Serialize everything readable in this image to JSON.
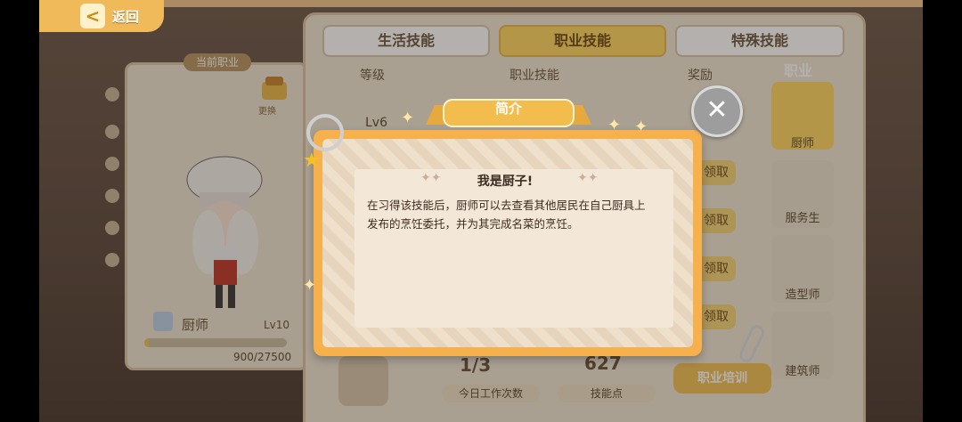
{
  "topbar": {
    "back_label": "返回"
  },
  "character": {
    "job_tag": "当前职业",
    "change_label": "更换",
    "name": "厨师",
    "level": "Lv10",
    "xp_text": "900/27500",
    "xp_fraction": 0.0327
  },
  "tabs": [
    {
      "label": "生活技能"
    },
    {
      "label": "职业技能"
    },
    {
      "label": "特殊技能"
    }
  ],
  "table": {
    "headers": [
      "等级",
      "职业技能",
      "奖励"
    ],
    "first_row_level": "Lv6",
    "claim_label": "领取"
  },
  "job_list": {
    "title": "职业",
    "items": [
      "厨师",
      "服务生",
      "造型师",
      "建筑师"
    ]
  },
  "stats": {
    "count_value": "1/3",
    "count_label": "今日工作次数",
    "points_value": "627",
    "points_label": "技能点",
    "train_label": "职业培训"
  },
  "modal": {
    "title": "简介",
    "heading": "我是厨子!",
    "text": "在习得该技能后，厨师可以去查看其他居民在自己厨具上发布的烹饪委托，并为其完成名菜的烹饪。",
    "close_icon": "close-icon"
  }
}
